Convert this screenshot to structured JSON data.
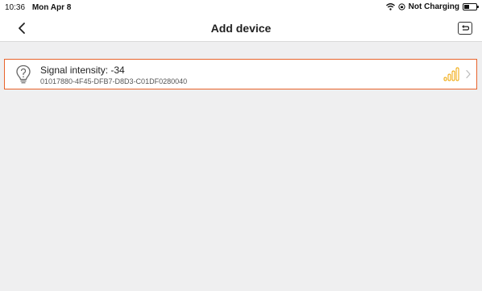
{
  "status": {
    "time": "10:36",
    "date": "Mon Apr 8",
    "charging": "Not Charging",
    "battery_level": 0.45
  },
  "nav": {
    "title": "Add device",
    "back_icon": "chevron-left-icon",
    "exit_icon": "return-icon"
  },
  "devices": [
    {
      "name": "Signal intensity: -34",
      "id": "01017880-4F45-DFB7-D8D3-C01DF0280040",
      "icon": "lightbulb-icon",
      "signal_bars": 4
    }
  ],
  "colors": {
    "accent": "#e8632b",
    "signal": "#f0a500",
    "background": "#efeff0"
  }
}
